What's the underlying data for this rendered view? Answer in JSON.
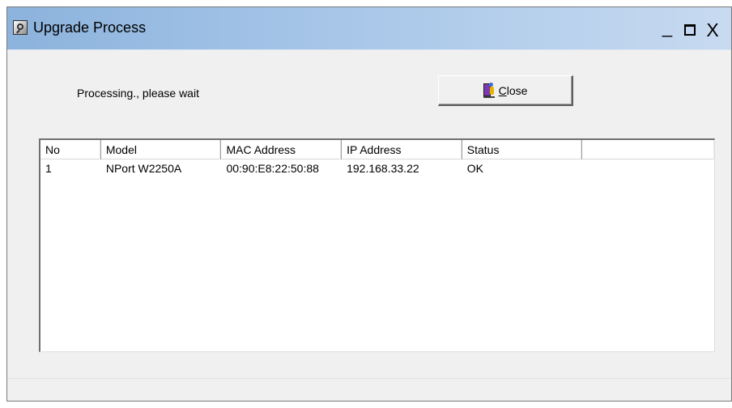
{
  "window": {
    "title": "Upgrade Process",
    "controls": {
      "minimize": "_",
      "close": "X"
    }
  },
  "main": {
    "status_text": "Processing., please wait",
    "close_button": {
      "mnemonic": "C",
      "rest": "lose",
      "icon": "exit-door-icon"
    }
  },
  "table": {
    "headers": [
      "No",
      "Model",
      "MAC Address",
      "IP Address",
      "Status",
      ""
    ],
    "rows": [
      [
        "1",
        "NPort W2250A",
        "00:90:E8:22:50:88",
        "192.168.33.22",
        "OK",
        ""
      ]
    ]
  },
  "colors": {
    "titlebar_start": "#8cb3dd",
    "titlebar_end": "#c7daf0",
    "dialog_bg": "#f0f0f0",
    "list_bg": "#ffffff"
  }
}
